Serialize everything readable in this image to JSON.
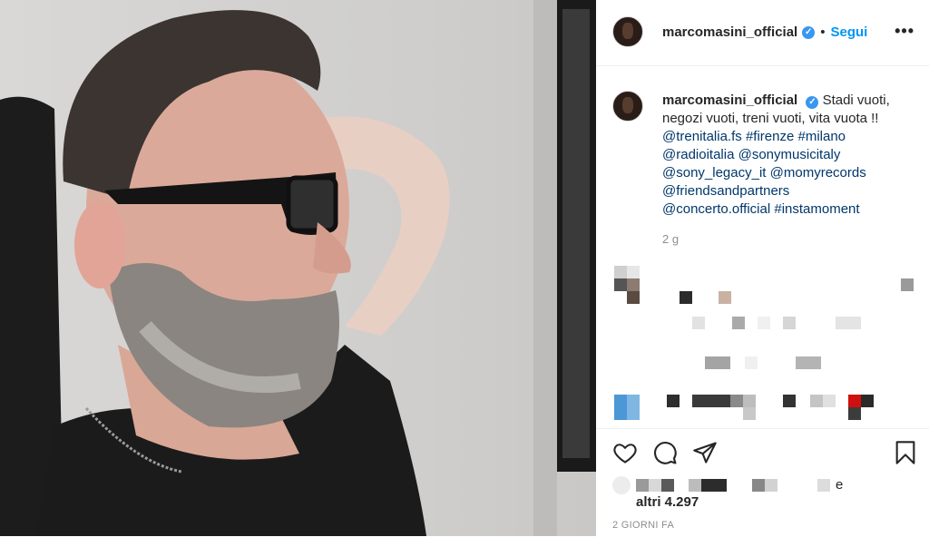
{
  "post": {
    "username": "marcomasini_official",
    "verified_glyph": "✓",
    "separator": "•",
    "follow_label": "Segui",
    "more_label": "•••"
  },
  "caption": {
    "username": "marcomasini_official",
    "text": "Stadi vuoti, negozi vuoti, treni vuoti, vita vuota !!",
    "tags": [
      "@trenitalia.fs",
      "#firenze",
      "#milano",
      "@radioitalia",
      "@sonymusicitaly",
      "@sony_legacy_it",
      "@momyrecords",
      "@friendsandpartners",
      "@concerto.official",
      "#instamoment"
    ],
    "age": "2 g"
  },
  "actions": {
    "icons": [
      "heart-icon",
      "comment-icon",
      "share-icon",
      "bookmark-icon"
    ]
  },
  "likes": {
    "liked_by_suffix": "e",
    "others": "altri 4.297"
  },
  "timestamp": "2 GIORNI FA",
  "colors": {
    "link": "#00376b",
    "follow": "#0095f6",
    "verified": "#3897f0",
    "muted": "#8e8e8e"
  }
}
